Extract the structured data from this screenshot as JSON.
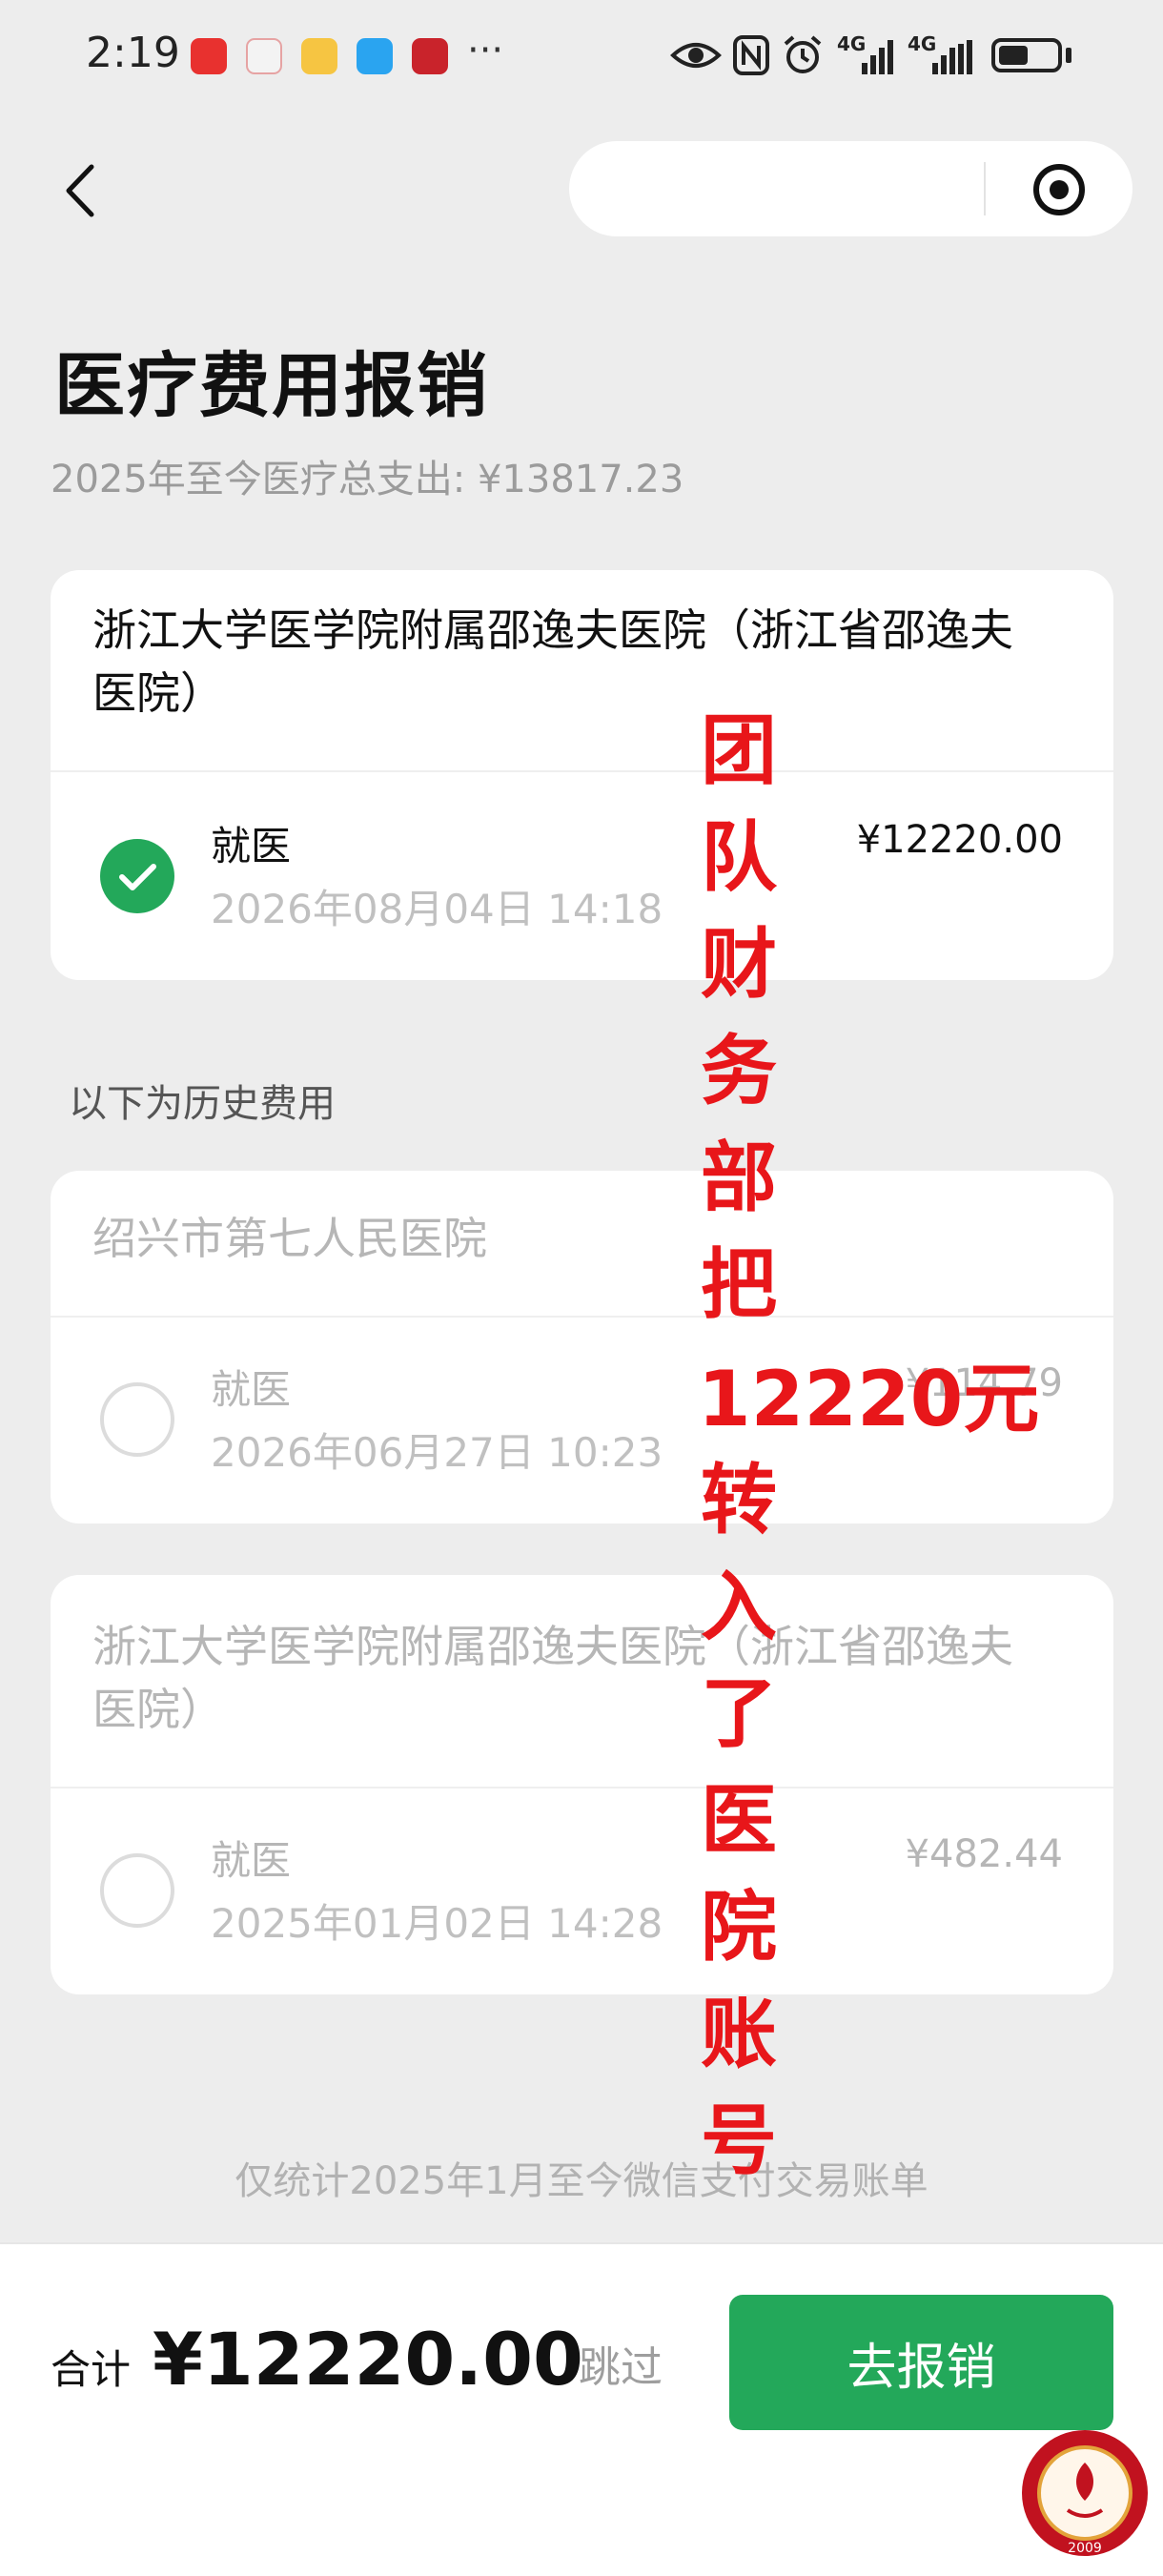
{
  "status_bar": {
    "time": "2:19",
    "overflow": "···",
    "app_icons": [
      "huawei-icon",
      "red-box-icon",
      "weibo-icon",
      "chat-bubble-icon",
      "red-circle-icon"
    ],
    "net_label_1": "4G",
    "net_label_2": "4G"
  },
  "nav": {
    "back_icon": "back-chevron-icon",
    "capsule_icon": "target-icon"
  },
  "header": {
    "title": "医疗费用报销",
    "subtitle": "2025年至今医疗总支出: ¥13817.23"
  },
  "current_card": {
    "hospital": "浙江大学医学院附属邵逸夫医院（浙江省邵逸夫医院）",
    "type": "就医",
    "date": "2026年08月04日 14:18",
    "amount": "¥12220.00",
    "selected": true
  },
  "history_label": "以下为历史费用",
  "history": [
    {
      "hospital": "绍兴市第七人民医院",
      "type": "就医",
      "date": "2026年06月27日 10:23",
      "amount": "¥114.79",
      "selected": false
    },
    {
      "hospital": "浙江大学医学院附属邵逸夫医院（浙江省邵逸夫医院）",
      "type": "就医",
      "date": "2025年01月02日 14:28",
      "amount": "¥482.44",
      "selected": false
    }
  ],
  "footer_note": "仅统计2025年1月至今微信支付交易账单",
  "bottom_bar": {
    "total_label": "合计",
    "total_amount": "¥12220.00",
    "skip_label": "跳过",
    "submit_label": "去报销"
  },
  "overlay": {
    "chars_top": [
      "团",
      "队",
      "财",
      "务",
      "部",
      "把"
    ],
    "number": "12220元",
    "chars_bottom": [
      "转",
      "入",
      "了",
      "医",
      "院",
      "账",
      "号"
    ]
  },
  "colors": {
    "accent": "#23a85a",
    "overlay_red": "#e8161a",
    "background": "#ededed"
  },
  "seal": {
    "year": "2009",
    "icon": "seal-emblem-icon"
  }
}
